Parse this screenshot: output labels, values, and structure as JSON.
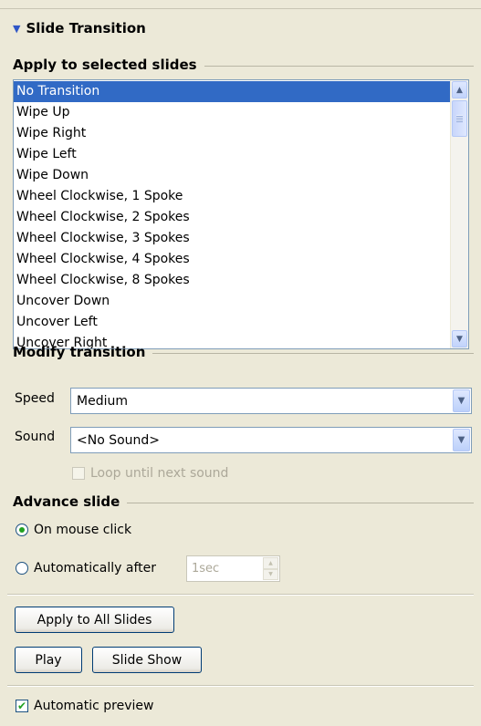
{
  "panel": {
    "title": "Slide Transition"
  },
  "apply_section": {
    "label": "Apply to selected slides",
    "selected_index": 0,
    "items": [
      "No Transition",
      "Wipe Up",
      "Wipe Right",
      "Wipe Left",
      "Wipe Down",
      "Wheel Clockwise, 1 Spoke",
      "Wheel Clockwise, 2 Spokes",
      "Wheel Clockwise, 3 Spokes",
      "Wheel Clockwise, 4 Spokes",
      "Wheel Clockwise, 8 Spokes",
      "Uncover Down",
      "Uncover Left",
      "Uncover Right"
    ]
  },
  "modify_section": {
    "label": "Modify transition",
    "speed_label": "Speed",
    "speed_value": "Medium",
    "sound_label": "Sound",
    "sound_value": "<No Sound>",
    "loop_label": "Loop until next sound",
    "loop_checked": false,
    "loop_enabled": false
  },
  "advance_section": {
    "label": "Advance slide",
    "on_click_label": "On mouse click",
    "auto_label": "Automatically after",
    "auto_value": "1sec",
    "selected": "on_click"
  },
  "buttons": {
    "apply_all": "Apply to All Slides",
    "play": "Play",
    "slide_show": "Slide Show"
  },
  "preview": {
    "label": "Automatic preview",
    "checked": true
  },
  "icons": {
    "collapse": "triangle-down-icon",
    "scroll_up": "scroll-up-arrow-icon",
    "scroll_down": "scroll-down-arrow-icon",
    "dropdown": "chevron-down-icon",
    "checkmark": "check-icon"
  },
  "colors": {
    "selection": "#316ac5",
    "panel_bg": "#ece9d8",
    "check_green": "#21a121"
  }
}
